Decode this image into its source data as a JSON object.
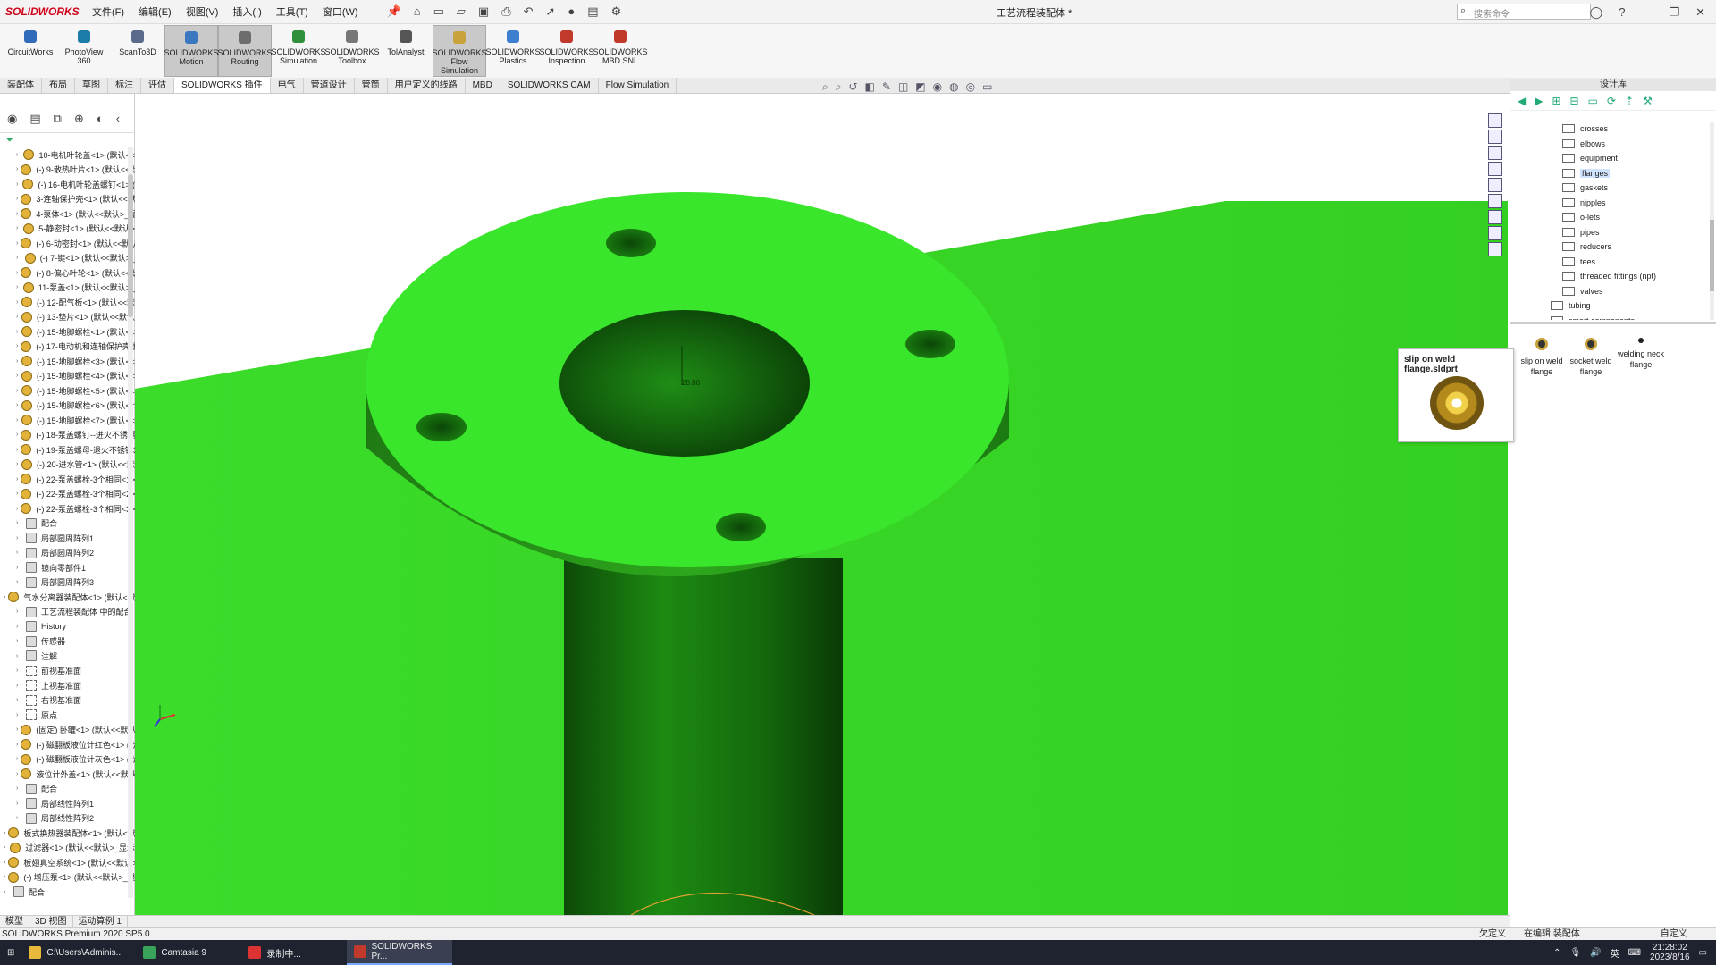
{
  "titlebar": {
    "app_logo": "SOLIDWORKS",
    "menus": [
      "文件(F)",
      "编辑(E)",
      "视图(V)",
      "插入(I)",
      "工具(T)",
      "窗口(W)"
    ],
    "document_title": "工艺流程装配体 *",
    "search_placeholder": "搜索命令"
  },
  "command_manager": {
    "buttons": [
      {
        "label": "CircuitWorks",
        "active": false,
        "color": "#2f6bb8"
      },
      {
        "label": "PhotoView 360",
        "active": false,
        "color": "#1c7ea8"
      },
      {
        "label": "ScanTo3D",
        "active": false,
        "color": "#5a6a8a"
      },
      {
        "label": "SOLIDWORKS Motion",
        "active": true,
        "color": "#3a78c0"
      },
      {
        "label": "SOLIDWORKS Routing",
        "active": true,
        "color": "#6d6d6d"
      },
      {
        "label": "SOLIDWORKS Simulation",
        "active": false,
        "color": "#2f8f3a"
      },
      {
        "label": "SOLIDWORKS Toolbox",
        "active": false,
        "color": "#777777"
      },
      {
        "label": "TolAnalyst",
        "active": false,
        "color": "#555555"
      },
      {
        "label": "SOLIDWORKS Flow Simulation",
        "active": true,
        "color": "#c8a23a"
      },
      {
        "label": "SOLIDWORKS Plastics",
        "active": false,
        "color": "#3f7fd0"
      },
      {
        "label": "SOLIDWORKS Inspection",
        "active": false,
        "color": "#c0392b"
      },
      {
        "label": "SOLIDWORKS MBD SNL",
        "active": false,
        "color": "#c0392b"
      }
    ]
  },
  "tabs": [
    "装配体",
    "布局",
    "草图",
    "标注",
    "评估",
    "SOLIDWORKS 插件",
    "电气",
    "管道设计",
    "管筒",
    "用户定义的线路",
    "MBD",
    "SOLIDWORKS CAM",
    "Flow Simulation"
  ],
  "active_tab": "SOLIDWORKS 插件",
  "feature_tree": {
    "items": [
      {
        "label": "10-电机叶轮盖<1> (默认<<",
        "level": 1,
        "icon": "part"
      },
      {
        "label": "(-) 9-散热叶片<1> (默认<<默",
        "level": 1,
        "icon": "part"
      },
      {
        "label": "(-) 16-电机叶轮盖螺钉<1> (",
        "level": 1,
        "icon": "part"
      },
      {
        "label": "3-连轴保护壳<1> (默认<<默",
        "level": 1,
        "icon": "part"
      },
      {
        "label": "4-泵体<1> (默认<<默认>_显",
        "level": 1,
        "icon": "part"
      },
      {
        "label": "5-静密封<1> (默认<<默认>",
        "level": 1,
        "icon": "part"
      },
      {
        "label": "(-) 6-动密封<1> (默认<<默认",
        "level": 1,
        "icon": "part"
      },
      {
        "label": "(-) 7-键<1> (默认<<默认>_",
        "level": 1,
        "icon": "part"
      },
      {
        "label": "(-) 8-偏心叶轮<1> (默认<<默",
        "level": 1,
        "icon": "part"
      },
      {
        "label": "11-泵盖<1> (默认<<默认>_",
        "level": 1,
        "icon": "part"
      },
      {
        "label": "(-) 12-配气板<1> (默认<<默",
        "level": 1,
        "icon": "part"
      },
      {
        "label": "(-) 13-垫片<1> (默认<<默认",
        "level": 1,
        "icon": "part"
      },
      {
        "label": "(-) 15-地脚螺栓<1> (默认<<",
        "level": 1,
        "icon": "part"
      },
      {
        "label": "(-) 17-电动机和连轴保护壳螺",
        "level": 1,
        "icon": "part"
      },
      {
        "label": "(-) 15-地脚螺栓<3> (默认<<",
        "level": 1,
        "icon": "part"
      },
      {
        "label": "(-) 15-地脚螺栓<4> (默认<<",
        "level": 1,
        "icon": "part"
      },
      {
        "label": "(-) 15-地脚螺栓<5> (默认<<",
        "level": 1,
        "icon": "part"
      },
      {
        "label": "(-) 15-地脚螺栓<6> (默认<<",
        "level": 1,
        "icon": "part"
      },
      {
        "label": "(-) 15-地脚螺栓<7> (默认<<",
        "level": 1,
        "icon": "part"
      },
      {
        "label": "(-) 18-泵盖螺钉--进火不锈钢",
        "level": 1,
        "icon": "part"
      },
      {
        "label": "(-) 19-泵盖螺母-退火不锈钢3",
        "level": 1,
        "icon": "part"
      },
      {
        "label": "(-) 20-进水管<1> (默认<<默",
        "level": 1,
        "icon": "part"
      },
      {
        "label": "(-) 22-泵盖螺栓-3个相同<1>",
        "level": 1,
        "icon": "part"
      },
      {
        "label": "(-) 22-泵盖螺栓-3个相同<2>",
        "level": 1,
        "icon": "part"
      },
      {
        "label": "(-) 22-泵盖螺栓-3个相同<3>",
        "level": 1,
        "icon": "part"
      },
      {
        "label": "配合",
        "level": 1,
        "icon": "folder"
      },
      {
        "label": "局部圆周阵列1",
        "level": 1,
        "icon": "folder"
      },
      {
        "label": "局部圆周阵列2",
        "level": 1,
        "icon": "folder"
      },
      {
        "label": "镜向零部件1",
        "level": 1,
        "icon": "folder"
      },
      {
        "label": "局部圆周阵列3",
        "level": 1,
        "icon": "folder"
      },
      {
        "label": "气水分离器装配体<1> (默认<默",
        "level": 0,
        "icon": "part"
      },
      {
        "label": "工艺流程装配体 中的配合",
        "level": 1,
        "icon": "folder"
      },
      {
        "label": "History",
        "level": 1,
        "icon": "folder"
      },
      {
        "label": "传感器",
        "level": 1,
        "icon": "folder"
      },
      {
        "label": "注解",
        "level": 1,
        "icon": "folder"
      },
      {
        "label": "前视基准面",
        "level": 1,
        "icon": "plane"
      },
      {
        "label": "上视基准面",
        "level": 1,
        "icon": "plane"
      },
      {
        "label": "右视基准面",
        "level": 1,
        "icon": "plane"
      },
      {
        "label": "原点",
        "level": 1,
        "icon": "plane"
      },
      {
        "label": "(固定) 卧罐<1> (默认<<默认",
        "level": 1,
        "icon": "part"
      },
      {
        "label": "(-) 磁翻板液位计红色<1> (默",
        "level": 1,
        "icon": "part"
      },
      {
        "label": "(-) 磁翻板液位计灰色<1> (默",
        "level": 1,
        "icon": "part"
      },
      {
        "label": "液位计外盖<1> (默认<<默认",
        "level": 1,
        "icon": "part"
      },
      {
        "label": "配合",
        "level": 1,
        "icon": "folder"
      },
      {
        "label": "局部线性阵列1",
        "level": 1,
        "icon": "folder"
      },
      {
        "label": "局部线性阵列2",
        "level": 1,
        "icon": "folder"
      },
      {
        "label": "板式换热器装配体<1> (默认<默",
        "level": 0,
        "icon": "part"
      },
      {
        "label": "过滤器<1> (默认<<默认>_显示",
        "level": 0,
        "icon": "part"
      },
      {
        "label": "板翅真空系统<1> (默认<<默认>",
        "level": 0,
        "icon": "part"
      },
      {
        "label": "(-) 增压泵<1> (默认<<默认>_显",
        "level": 0,
        "icon": "part"
      },
      {
        "label": "配合",
        "level": 0,
        "icon": "folder"
      }
    ]
  },
  "bottom_tabs": [
    "模型",
    "3D 视图",
    "运动算例 1"
  ],
  "statusbar": {
    "left": "SOLIDWORKS Premium 2020 SP5.0",
    "center": "欠定义",
    "center2": "在编辑 装配体",
    "right": "自定义"
  },
  "design_library": {
    "title": "设计库",
    "items": [
      {
        "label": "crosses",
        "selected": false
      },
      {
        "label": "elbows",
        "selected": false
      },
      {
        "label": "equipment",
        "selected": false
      },
      {
        "label": "flanges",
        "selected": true
      },
      {
        "label": "gaskets",
        "selected": false
      },
      {
        "label": "nipples",
        "selected": false
      },
      {
        "label": "o-lets",
        "selected": false
      },
      {
        "label": "pipes",
        "selected": false
      },
      {
        "label": "reducers",
        "selected": false
      },
      {
        "label": "tees",
        "selected": false
      },
      {
        "label": "threaded fittings (npt)",
        "selected": false
      },
      {
        "label": "valves",
        "selected": false
      },
      {
        "label": "tubing",
        "selected": false
      },
      {
        "label": "smart components",
        "selected": false
      }
    ],
    "thumbnails": [
      {
        "label": "slip on weld flange"
      },
      {
        "label": "socket weld flange"
      },
      {
        "label": "welding neck flange"
      }
    ],
    "tooltip_title": "slip on weld flange.sldprt"
  },
  "viewport": {
    "dimension_text": "28.80",
    "model_color": "#39e62b",
    "floor_color": "#2fd31f"
  },
  "taskbar": {
    "items": [
      {
        "label": "C:\\Users\\Adminis...",
        "active": false,
        "color": "#e8b93a"
      },
      {
        "label": "Camtasia 9",
        "active": false,
        "color": "#3aa35a"
      },
      {
        "label": "录制中...",
        "active": false,
        "color": "#d33"
      },
      {
        "label": "SOLIDWORKS Pr...",
        "active": true,
        "color": "#c0392b"
      }
    ],
    "time": "21:28:02",
    "date": "2023/8/16",
    "ime": "英"
  }
}
